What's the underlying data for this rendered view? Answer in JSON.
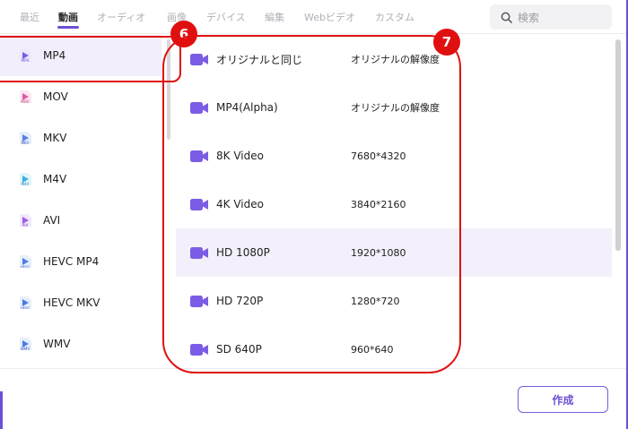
{
  "tabs": [
    {
      "label": "最近"
    },
    {
      "label": "動画"
    },
    {
      "label": "オーディオ"
    },
    {
      "label": "画像"
    },
    {
      "label": "デバイス"
    },
    {
      "label": "編集"
    },
    {
      "label": "Webビデオ"
    },
    {
      "label": "カスタム"
    }
  ],
  "active_tab": "動画",
  "search": {
    "placeholder": "検索"
  },
  "formats": [
    {
      "label": "MP4",
      "icon_text": "MP4",
      "selected": true
    },
    {
      "label": "MOV",
      "icon_text": "MOV"
    },
    {
      "label": "MKV",
      "icon_text": "MKV"
    },
    {
      "label": "M4V",
      "icon_text": "M4V"
    },
    {
      "label": "AVI",
      "icon_text": "AVI"
    },
    {
      "label": "HEVC MP4",
      "icon_text": "HEVC"
    },
    {
      "label": "HEVC MKV",
      "icon_text": "HEVC"
    },
    {
      "label": "WMV",
      "icon_text": "WMV"
    }
  ],
  "presets": [
    {
      "name": "オリジナルと同じ",
      "resolution": "オリジナルの解像度"
    },
    {
      "name": "MP4(Alpha)",
      "resolution": "オリジナルの解像度"
    },
    {
      "name": "8K Video",
      "resolution": "7680*4320"
    },
    {
      "name": "4K Video",
      "resolution": "3840*2160"
    },
    {
      "name": "HD 1080P",
      "resolution": "1920*1080",
      "highlighted": true
    },
    {
      "name": "HD 720P",
      "resolution": "1280*720"
    },
    {
      "name": "SD 640P",
      "resolution": "960*640"
    }
  ],
  "footer": {
    "create_label": "作成"
  },
  "annotations": {
    "badge_6": "6",
    "badge_7": "7",
    "color": "#e01010"
  },
  "colors": {
    "accent": "#6d4fd6",
    "selected_bg": "#f2eefc"
  }
}
